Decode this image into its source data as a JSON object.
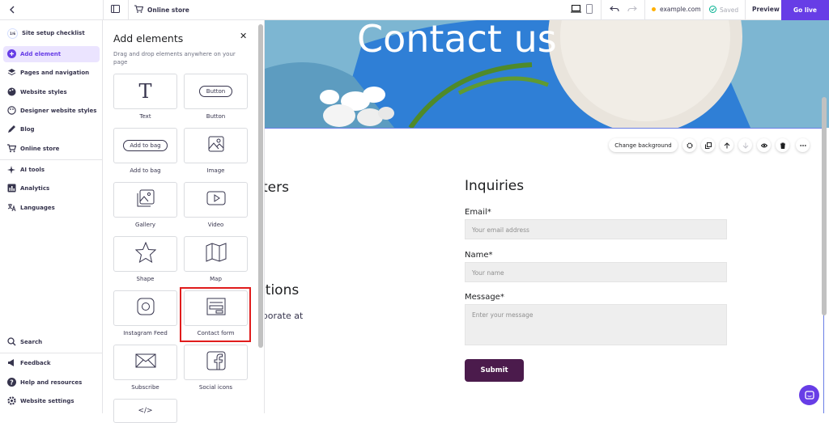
{
  "topbar": {
    "store_label": "Online store",
    "domain": "example.com",
    "saved_label": "Saved",
    "preview_label": "Preview",
    "go_live_label": "Go live"
  },
  "sidebar": {
    "setup": "Site setup checklist",
    "items": [
      {
        "label": "Add element",
        "icon": "plus-circle-icon"
      },
      {
        "label": "Pages and navigation",
        "icon": "layers-icon"
      },
      {
        "label": "Website styles",
        "icon": "palette-icon"
      },
      {
        "label": "Designer website styles",
        "icon": "palette-icon"
      },
      {
        "label": "Blog",
        "icon": "pen-icon"
      },
      {
        "label": "Online store",
        "icon": "cart-icon"
      },
      {
        "label": "AI tools",
        "icon": "sparkle-icon"
      },
      {
        "label": "Analytics",
        "icon": "bar-chart-icon"
      },
      {
        "label": "Languages",
        "icon": "translate-icon"
      }
    ],
    "bottom": [
      {
        "label": "Search",
        "icon": "search-icon"
      },
      {
        "label": "Feedback",
        "icon": "megaphone-icon"
      },
      {
        "label": "Help and resources",
        "icon": "help-icon"
      },
      {
        "label": "Website settings",
        "icon": "gear-icon"
      }
    ]
  },
  "panel": {
    "title": "Add elements",
    "subtitle": "Drag and drop elements anywhere on your page",
    "tiles": [
      {
        "label": "Text"
      },
      {
        "label": "Button"
      },
      {
        "label": "Add to bag"
      },
      {
        "label": "Image"
      },
      {
        "label": "Gallery"
      },
      {
        "label": "Video"
      },
      {
        "label": "Shape"
      },
      {
        "label": "Map"
      },
      {
        "label": "Instagram Feed"
      },
      {
        "label": "Contact form"
      },
      {
        "label": "Subscribe"
      },
      {
        "label": "Social icons"
      }
    ],
    "button_preview": "Button",
    "bag_preview": "Add to bag"
  },
  "canvas": {
    "hero_title": "Contact us",
    "change_background": "Change background",
    "left_heading_1": "rters",
    "left_heading_2": "utions",
    "left_text_1": "aborate at",
    "left_text_2": "n",
    "inquiries": "Inquiries",
    "email_label": "Email*",
    "email_placeholder": "Your email address",
    "name_label": "Name*",
    "name_placeholder": "Your name",
    "message_label": "Message*",
    "message_placeholder": "Enter your message",
    "submit_label": "Submit"
  },
  "colors": {
    "accent": "#673de6",
    "submit": "#4b1b4c",
    "highlight": "#e01c1c"
  }
}
